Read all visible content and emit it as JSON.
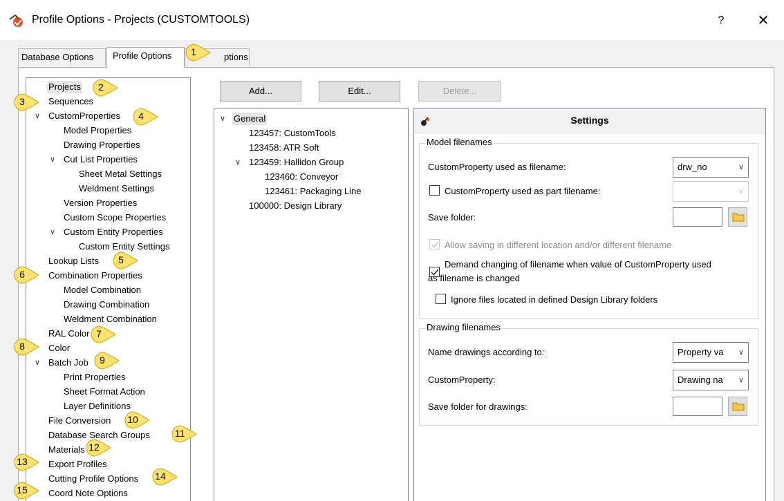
{
  "window": {
    "title": "Profile Options - Projects (CUSTOMTOOLS)",
    "help_label": "?",
    "close_label": "✕"
  },
  "tabs": [
    {
      "label": "Database Options"
    },
    {
      "label": "Profile Options"
    },
    {
      "label": "ptions"
    }
  ],
  "toolbar": {
    "add_label": "Add...",
    "edit_label": "Edit...",
    "delete_label": "Delete..."
  },
  "left_tree": {
    "items": [
      {
        "label": "Projects",
        "selected": true
      },
      {
        "label": "Sequences"
      },
      {
        "label": "CustomProperties",
        "expanded": true
      },
      {
        "label": "Model Properties"
      },
      {
        "label": "Drawing Properties"
      },
      {
        "label": "Cut List Properties",
        "expanded": true
      },
      {
        "label": "Sheet Metal Settings"
      },
      {
        "label": "Weldment Settings"
      },
      {
        "label": "Version Properties"
      },
      {
        "label": "Custom Scope Properties"
      },
      {
        "label": "Custom Entity Properties",
        "expanded": true
      },
      {
        "label": "Custom Entity Settings"
      },
      {
        "label": "Lookup Lists"
      },
      {
        "label": "Combination Properties"
      },
      {
        "label": "Model Combination"
      },
      {
        "label": "Drawing Combination"
      },
      {
        "label": "Weldment Combination"
      },
      {
        "label": "RAL Color"
      },
      {
        "label": "Color"
      },
      {
        "label": "Batch Job",
        "expanded": true
      },
      {
        "label": "Print Properties"
      },
      {
        "label": "Sheet Format Action"
      },
      {
        "label": "Layer Definitions"
      },
      {
        "label": "File Conversion"
      },
      {
        "label": "Database Search Groups"
      },
      {
        "label": "Materials"
      },
      {
        "label": "Export Profiles"
      },
      {
        "label": "Cutting Profile Options"
      },
      {
        "label": "Coord Note Options"
      }
    ]
  },
  "project_tree": {
    "items": [
      {
        "label": "General",
        "selected": true,
        "expanded": true
      },
      {
        "label": "123457: CustomTools"
      },
      {
        "label": "123458: ATR Soft"
      },
      {
        "label": "123459: Hallidon Group",
        "expanded": true
      },
      {
        "label": "123460: Conveyor"
      },
      {
        "label": "123461: Packaging Line"
      },
      {
        "label": "100000: Design Library"
      }
    ]
  },
  "settings": {
    "title": "Settings",
    "model_group": {
      "title": "Model filenames",
      "cp_filename_label": "CustomProperty used as filename:",
      "cp_filename_value": "drw_no",
      "cp_part_filename_label": "CustomProperty used as part filename:",
      "cp_part_filename_checked": false,
      "cp_part_filename_value": "",
      "save_folder_label": "Save folder:",
      "save_folder_value": "",
      "allow_saving_label": "Allow saving in different location and/or different filename",
      "allow_saving_checked": true,
      "demand_change_label_1": "Demand changing of filename when value of CustomProperty used",
      "demand_change_label_2": "as filename is changed",
      "demand_change_checked": true,
      "ignore_library_label": "Ignore files located in defined Design Library folders",
      "ignore_library_checked": false
    },
    "drawing_group": {
      "title": "Drawing filenames",
      "name_according_label": "Name drawings according to:",
      "name_according_value": "Property va",
      "custom_property_label": "CustomProperty:",
      "custom_property_value": "Drawing na",
      "save_folder_label": "Save folder for drawings:",
      "save_folder_value": ""
    }
  },
  "callouts": [
    "1",
    "2",
    "3",
    "4",
    "5",
    "6",
    "7",
    "8",
    "9",
    "10",
    "11",
    "12",
    "13",
    "14",
    "15"
  ],
  "colors": {
    "callout_fill": "#ffe36e",
    "callout_stroke": "#c9a400",
    "selection": "#e5e5e5",
    "app_icon": "#e8501e"
  }
}
